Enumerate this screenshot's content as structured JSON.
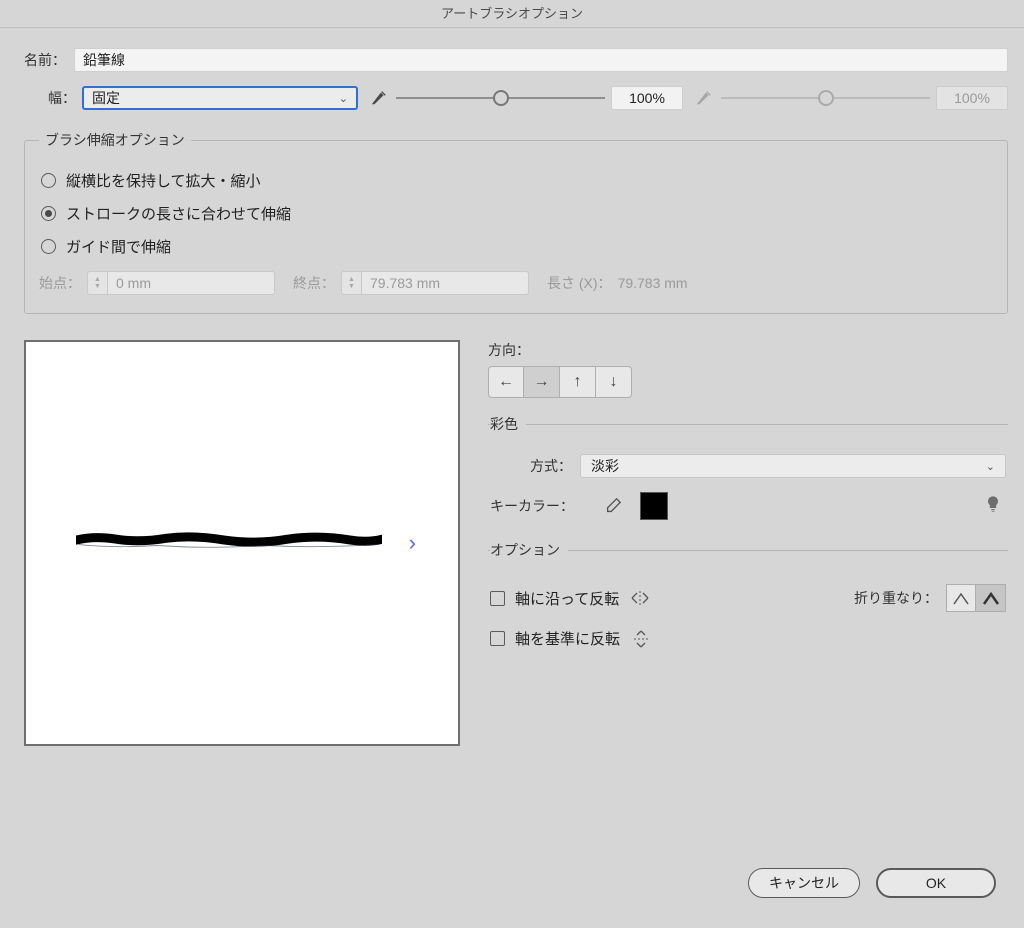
{
  "title": "アートブラシオプション",
  "name": {
    "label": "名前：",
    "value": "鉛筆線"
  },
  "width": {
    "label": "幅：",
    "select": "固定",
    "percent1": "100%",
    "percent2": "100%"
  },
  "stretch": {
    "legend": "ブラシ伸縮オプション",
    "opt1": "縦横比を保持して拡大・縮小",
    "opt2": "ストロークの長さに合わせて伸縮",
    "opt3": "ガイド間で伸縮",
    "start_label": "始点：",
    "start_value": "0 mm",
    "end_label": "終点：",
    "end_value": "79.783 mm",
    "length_label": "長さ (X)：",
    "length_value": "79.783 mm"
  },
  "direction": {
    "label": "方向："
  },
  "colorization": {
    "legend": "彩色",
    "method_label": "方式：",
    "method_value": "淡彩",
    "keycolor_label": "キーカラー："
  },
  "options": {
    "legend": "オプション",
    "flip_along": "軸に沿って反転",
    "flip_across": "軸を基準に反転",
    "overlap_label": "折り重なり："
  },
  "buttons": {
    "cancel": "キャンセル",
    "ok": "OK"
  }
}
